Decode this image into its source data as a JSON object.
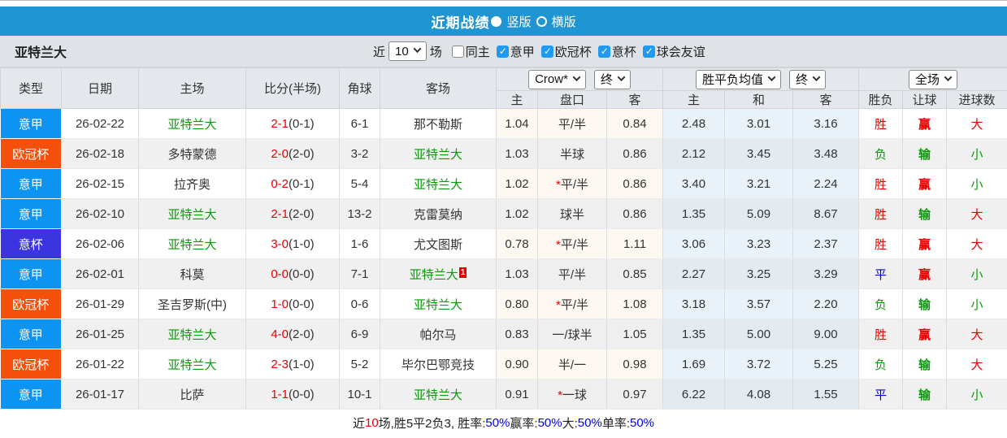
{
  "title_bar": {
    "title": "近期战绩",
    "radio_vertical": "竖版",
    "radio_horizontal": "横版"
  },
  "filter_bar": {
    "team": "亚特兰大",
    "near_label": "近",
    "games_value": "10",
    "games_label": "场",
    "same_home_label": "同主",
    "leagues": [
      "意甲",
      "欧冠杯",
      "意杯",
      "球会友谊"
    ]
  },
  "table": {
    "headers": {
      "main": [
        "类型",
        "日期",
        "主场",
        "比分(半场)",
        "角球",
        "客场"
      ],
      "sub": [
        "主",
        "盘口",
        "客",
        "主",
        "和",
        "客",
        "胜负",
        "让球",
        "进球数"
      ]
    },
    "selects": {
      "company": "Crow*",
      "company_time": "终",
      "avg": "胜平负均值",
      "avg_time": "终",
      "scope": "全场"
    },
    "rows": [
      {
        "type": "意甲",
        "type_color": "#0d93f2",
        "date": "26-02-22",
        "home": "亚特兰大",
        "home_green": true,
        "score": "2-1",
        "half": "(0-1)",
        "corner": "6-1",
        "away": "那不勒斯",
        "away_green": false,
        "away_sup": "",
        "odds_home": "1.04",
        "handicap": "平/半",
        "handicap_star": false,
        "odds_away": "0.84",
        "avg_home": "2.48",
        "avg_draw": "3.01",
        "avg_away": "3.16",
        "result": "胜",
        "result_color": "red",
        "handicap_result": "赢",
        "handicap_result_color": "red",
        "goals": "大",
        "goals_color": "red"
      },
      {
        "type": "欧冠杯",
        "type_color": "#f4500b",
        "date": "26-02-18",
        "home": "多特蒙德",
        "home_green": false,
        "score": "2-0",
        "half": "(2-0)",
        "corner": "3-2",
        "away": "亚特兰大",
        "away_green": true,
        "away_sup": "",
        "odds_home": "1.03",
        "handicap": "半球",
        "handicap_star": false,
        "odds_away": "0.86",
        "avg_home": "2.12",
        "avg_draw": "3.45",
        "avg_away": "3.48",
        "result": "负",
        "result_color": "green",
        "handicap_result": "输",
        "handicap_result_color": "green",
        "goals": "小",
        "goals_color": "green"
      },
      {
        "type": "意甲",
        "type_color": "#0d93f2",
        "date": "26-02-15",
        "home": "拉齐奥",
        "home_green": false,
        "score": "0-2",
        "half": "(0-1)",
        "corner": "5-4",
        "away": "亚特兰大",
        "away_green": true,
        "away_sup": "",
        "odds_home": "1.02",
        "handicap": "平/半",
        "handicap_star": true,
        "odds_away": "0.86",
        "avg_home": "3.40",
        "avg_draw": "3.21",
        "avg_away": "2.24",
        "result": "胜",
        "result_color": "red",
        "handicap_result": "赢",
        "handicap_result_color": "red",
        "goals": "小",
        "goals_color": "green"
      },
      {
        "type": "意甲",
        "type_color": "#0d93f2",
        "date": "26-02-10",
        "home": "亚特兰大",
        "home_green": true,
        "score": "2-1",
        "half": "(2-0)",
        "corner": "13-2",
        "away": "克雷莫纳",
        "away_green": false,
        "away_sup": "",
        "odds_home": "1.02",
        "handicap": "球半",
        "handicap_star": false,
        "odds_away": "0.86",
        "avg_home": "1.35",
        "avg_draw": "5.09",
        "avg_away": "8.67",
        "result": "胜",
        "result_color": "red",
        "handicap_result": "输",
        "handicap_result_color": "green",
        "goals": "大",
        "goals_color": "red"
      },
      {
        "type": "意杯",
        "type_color": "#3a35de",
        "date": "26-02-06",
        "home": "亚特兰大",
        "home_green": true,
        "score": "3-0",
        "half": "(1-0)",
        "corner": "1-6",
        "away": "尤文图斯",
        "away_green": false,
        "away_sup": "",
        "odds_home": "0.78",
        "handicap": "平/半",
        "handicap_star": true,
        "odds_away": "1.11",
        "avg_home": "3.06",
        "avg_draw": "3.23",
        "avg_away": "2.37",
        "result": "胜",
        "result_color": "red",
        "handicap_result": "赢",
        "handicap_result_color": "red",
        "goals": "大",
        "goals_color": "red"
      },
      {
        "type": "意甲",
        "type_color": "#0d93f2",
        "date": "26-02-01",
        "home": "科莫",
        "home_green": false,
        "score": "0-0",
        "half": "(0-0)",
        "corner": "7-1",
        "away": "亚特兰大",
        "away_green": true,
        "away_sup": "1",
        "odds_home": "1.03",
        "handicap": "平/半",
        "handicap_star": false,
        "odds_away": "0.85",
        "avg_home": "2.27",
        "avg_draw": "3.25",
        "avg_away": "3.29",
        "result": "平",
        "result_color": "blue",
        "handicap_result": "赢",
        "handicap_result_color": "red",
        "goals": "小",
        "goals_color": "green"
      },
      {
        "type": "欧冠杯",
        "type_color": "#f4500b",
        "date": "26-01-29",
        "home": "圣吉罗斯(中)",
        "home_green": false,
        "score": "1-0",
        "half": "(0-0)",
        "corner": "0-6",
        "away": "亚特兰大",
        "away_green": true,
        "away_sup": "",
        "odds_home": "0.80",
        "handicap": "平/半",
        "handicap_star": true,
        "odds_away": "1.08",
        "avg_home": "3.18",
        "avg_draw": "3.57",
        "avg_away": "2.20",
        "result": "负",
        "result_color": "green",
        "handicap_result": "输",
        "handicap_result_color": "green",
        "goals": "小",
        "goals_color": "green"
      },
      {
        "type": "意甲",
        "type_color": "#0d93f2",
        "date": "26-01-25",
        "home": "亚特兰大",
        "home_green": true,
        "score": "4-0",
        "half": "(2-0)",
        "corner": "6-9",
        "away": "帕尔马",
        "away_green": false,
        "away_sup": "",
        "odds_home": "0.83",
        "handicap": "一/球半",
        "handicap_star": false,
        "odds_away": "1.05",
        "avg_home": "1.35",
        "avg_draw": "5.00",
        "avg_away": "9.00",
        "result": "胜",
        "result_color": "red",
        "handicap_result": "赢",
        "handicap_result_color": "red",
        "goals": "大",
        "goals_color": "red"
      },
      {
        "type": "欧冠杯",
        "type_color": "#f4500b",
        "date": "26-01-22",
        "home": "亚特兰大",
        "home_green": true,
        "score": "2-3",
        "half": "(1-0)",
        "corner": "5-2",
        "away": "毕尔巴鄂竞技",
        "away_green": false,
        "away_sup": "",
        "odds_home": "0.90",
        "handicap": "半/一",
        "handicap_star": false,
        "odds_away": "0.98",
        "avg_home": "1.69",
        "avg_draw": "3.72",
        "avg_away": "5.25",
        "result": "负",
        "result_color": "green",
        "handicap_result": "输",
        "handicap_result_color": "green",
        "goals": "大",
        "goals_color": "red"
      },
      {
        "type": "意甲",
        "type_color": "#0d93f2",
        "date": "26-01-17",
        "home": "比萨",
        "home_green": false,
        "score": "1-1",
        "half": "(0-0)",
        "corner": "10-1",
        "away": "亚特兰大",
        "away_green": true,
        "away_sup": "",
        "odds_home": "0.91",
        "handicap": "一球",
        "handicap_star": true,
        "odds_away": "0.97",
        "avg_home": "6.22",
        "avg_draw": "4.08",
        "avg_away": "1.55",
        "result": "平",
        "result_color": "blue",
        "handicap_result": "输",
        "handicap_result_color": "green",
        "goals": "小",
        "goals_color": "green"
      }
    ]
  },
  "footer": {
    "segments": [
      {
        "text": "近",
        "color": "dark"
      },
      {
        "text": "10",
        "color": "red"
      },
      {
        "text": "场,胜5平2负3, 胜率:",
        "color": "dark"
      },
      {
        "text": "50%",
        "color": "blue"
      },
      {
        "text": " 赢率:",
        "color": "dark"
      },
      {
        "text": "50%",
        "color": "blue"
      },
      {
        "text": " 大:",
        "color": "dark"
      },
      {
        "text": "50%",
        "color": "blue"
      },
      {
        "text": " 单率:",
        "color": "dark"
      },
      {
        "text": "50%",
        "color": "blue"
      }
    ]
  }
}
